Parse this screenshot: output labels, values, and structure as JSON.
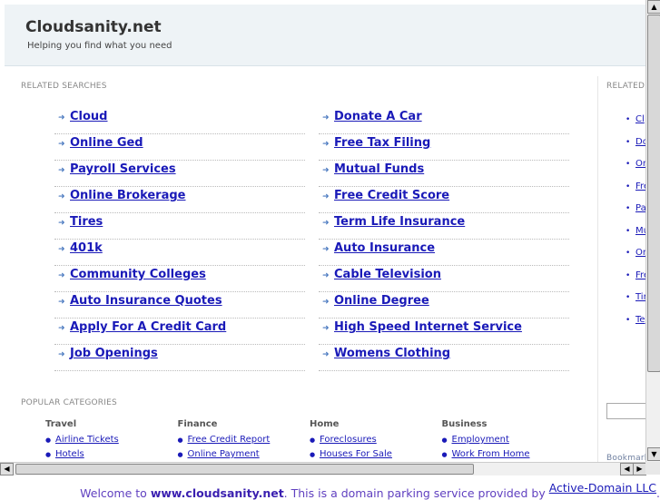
{
  "header": {
    "title": "Cloudsanity.net",
    "tagline": "Helping you find what you need"
  },
  "related": {
    "title": "RELATED SEARCHES",
    "left": [
      "Cloud",
      "Online Ged",
      "Payroll Services",
      "Online Brokerage",
      "Tires",
      "401k",
      "Community Colleges",
      "Auto Insurance Quotes",
      "Apply For A Credit Card",
      "Job Openings"
    ],
    "right": [
      "Donate A Car",
      "Free Tax Filing",
      "Mutual Funds",
      "Free Credit Score",
      "Term Life Insurance",
      "Auto Insurance",
      "Cable Television",
      "Online Degree",
      "High Speed Internet Service",
      "Womens Clothing"
    ]
  },
  "sidebar": {
    "title": "RELATED",
    "links": [
      "Cl",
      "Do",
      "Or",
      "Fre",
      "Pa",
      "Mu",
      "On",
      "Fre",
      "Tir",
      "Te"
    ],
    "bookmark": "Bookmark"
  },
  "popular": {
    "title": "POPULAR CATEGORIES",
    "categories": [
      {
        "name": "Travel",
        "links": [
          "Airline Tickets",
          "Hotels"
        ]
      },
      {
        "name": "Finance",
        "links": [
          "Free Credit Report",
          "Online Payment"
        ]
      },
      {
        "name": "Home",
        "links": [
          "Foreclosures",
          "Houses For Sale"
        ]
      },
      {
        "name": "Business",
        "links": [
          "Employment",
          "Work From Home"
        ]
      }
    ]
  },
  "footer": {
    "prefix": "Welcome to ",
    "domain": "www.cloudsanity.net",
    "middle": ". This is a domain parking service provided by ",
    "provider": "Active-Domain LLC",
    "suffix": "."
  },
  "icons": {
    "arrow": "arrow-right-icon",
    "bullet": "bullet-icon"
  },
  "colors": {
    "link": "#1a1ab8",
    "header_bg": "#eef3f6",
    "footer_text": "#6040c0"
  }
}
